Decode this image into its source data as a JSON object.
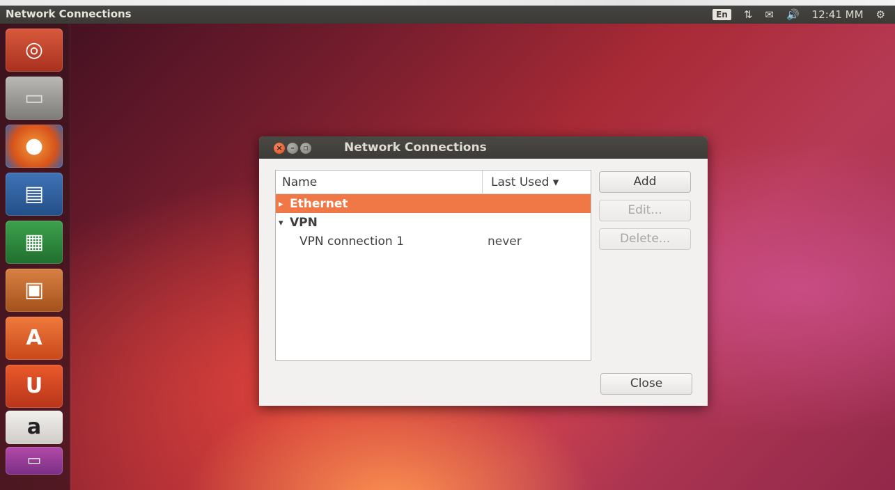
{
  "top_panel": {
    "app_title": "Network Connections",
    "keyboard_indicator": "En",
    "clock": "12:41 MM"
  },
  "launcher": {
    "items": [
      {
        "name": "dash-home",
        "color": "#c7412a"
      },
      {
        "name": "files",
        "color": "#8a8a88"
      },
      {
        "name": "firefox",
        "color": "#e8662b"
      },
      {
        "name": "libreoffice-writer",
        "color": "#2b5d9d"
      },
      {
        "name": "libreoffice-calc",
        "color": "#2a8a3b"
      },
      {
        "name": "libreoffice-impress",
        "color": "#c46a2a"
      },
      {
        "name": "software-center",
        "color": "#e45c1f"
      },
      {
        "name": "ubuntu-one",
        "color": "#d9461f"
      },
      {
        "name": "amazon",
        "color": "#e9e6e2"
      }
    ]
  },
  "dialog": {
    "title": "Network Connections",
    "columns": {
      "name": "Name",
      "last_used": "Last Used ▾"
    },
    "rows": [
      {
        "expander": "▸",
        "name": "Ethernet",
        "last_used": "",
        "selected": true,
        "bold": true,
        "indent": 0
      },
      {
        "expander": "▾",
        "name": "VPN",
        "last_used": "",
        "selected": false,
        "bold": true,
        "indent": 0
      },
      {
        "expander": "",
        "name": "VPN connection 1",
        "last_used": "never",
        "selected": false,
        "bold": false,
        "indent": 1
      }
    ],
    "buttons": {
      "add": "Add",
      "edit": "Edit...",
      "delete": "Delete...",
      "close": "Close"
    }
  },
  "colors": {
    "accent": "#f07746",
    "panel": "#3c3b37"
  }
}
